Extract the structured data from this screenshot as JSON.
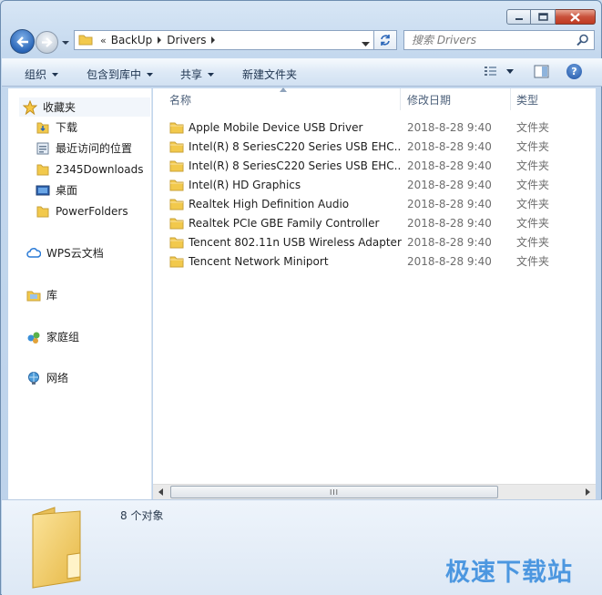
{
  "window": {
    "caption_buttons": [
      "minimize",
      "maximize",
      "close"
    ]
  },
  "address_bar": {
    "overflow": "«",
    "crumbs": [
      "BackUp",
      "Drivers"
    ],
    "search_placeholder": "搜索 Drivers"
  },
  "toolbar": {
    "organize": "组织",
    "include_in_library": "包含到库中",
    "share": "共享",
    "new_folder": "新建文件夹",
    "help": "?"
  },
  "nav_pane": {
    "favorites": "收藏夹",
    "favorites_items": [
      "下载",
      "最近访问的位置",
      "2345Downloads",
      "桌面",
      "PowerFolders"
    ],
    "wps_cloud": "WPS云文档",
    "library": "库",
    "homegroup": "家庭组",
    "network": "网络"
  },
  "columns": {
    "name": "名称",
    "date_modified": "修改日期",
    "type": "类型"
  },
  "files": [
    {
      "name": "Apple Mobile Device USB Driver",
      "date": "2018-8-28 9:40",
      "type": "文件夹"
    },
    {
      "name": "Intel(R) 8 SeriesC220 Series USB EHC...",
      "date": "2018-8-28 9:40",
      "type": "文件夹"
    },
    {
      "name": "Intel(R) 8 SeriesC220 Series USB EHC...",
      "date": "2018-8-28 9:40",
      "type": "文件夹"
    },
    {
      "name": "Intel(R) HD Graphics",
      "date": "2018-8-28 9:40",
      "type": "文件夹"
    },
    {
      "name": "Realtek High Definition Audio",
      "date": "2018-8-28 9:40",
      "type": "文件夹"
    },
    {
      "name": "Realtek PCIe GBE Family Controller",
      "date": "2018-8-28 9:40",
      "type": "文件夹"
    },
    {
      "name": "Tencent 802.11n USB Wireless Adapter",
      "date": "2018-8-28 9:40",
      "type": "文件夹"
    },
    {
      "name": "Tencent Network Miniport",
      "date": "2018-8-28 9:40",
      "type": "文件夹"
    }
  ],
  "scrollbar": {
    "grip": "III"
  },
  "details": {
    "count": "8 个对象"
  },
  "watermark": "极速下载站",
  "colors": {
    "folder": "#f2c94c",
    "watermark": "#4c97e0",
    "accent": "#2a66b8"
  }
}
